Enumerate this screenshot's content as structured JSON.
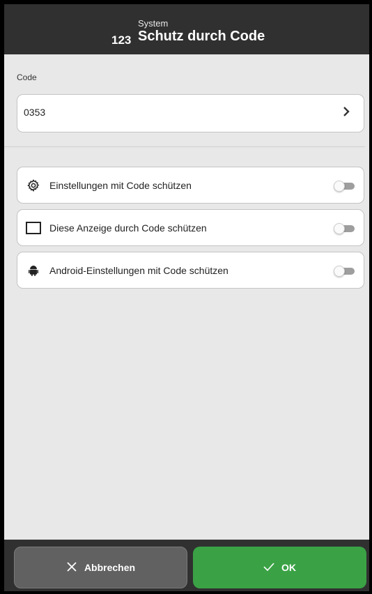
{
  "header": {
    "number": "123",
    "category": "System",
    "title": "Schutz durch Code"
  },
  "code": {
    "label": "Code",
    "value": "0353",
    "chevron": "›"
  },
  "options": [
    {
      "label": "Einstellungen mit Code schützen",
      "icon": "gear-icon",
      "enabled": false
    },
    {
      "label": "Diese Anzeige durch Code schützen",
      "icon": "screen-icon",
      "enabled": false
    },
    {
      "label": "Android-Einstellungen mit Code schützen",
      "icon": "android-icon",
      "enabled": false
    }
  ],
  "footer": {
    "cancel_label": "Abbrechen",
    "ok_label": "OK"
  },
  "colors": {
    "header_bg": "#303030",
    "ok_green": "#3aa245",
    "cancel_gray": "#616161"
  }
}
